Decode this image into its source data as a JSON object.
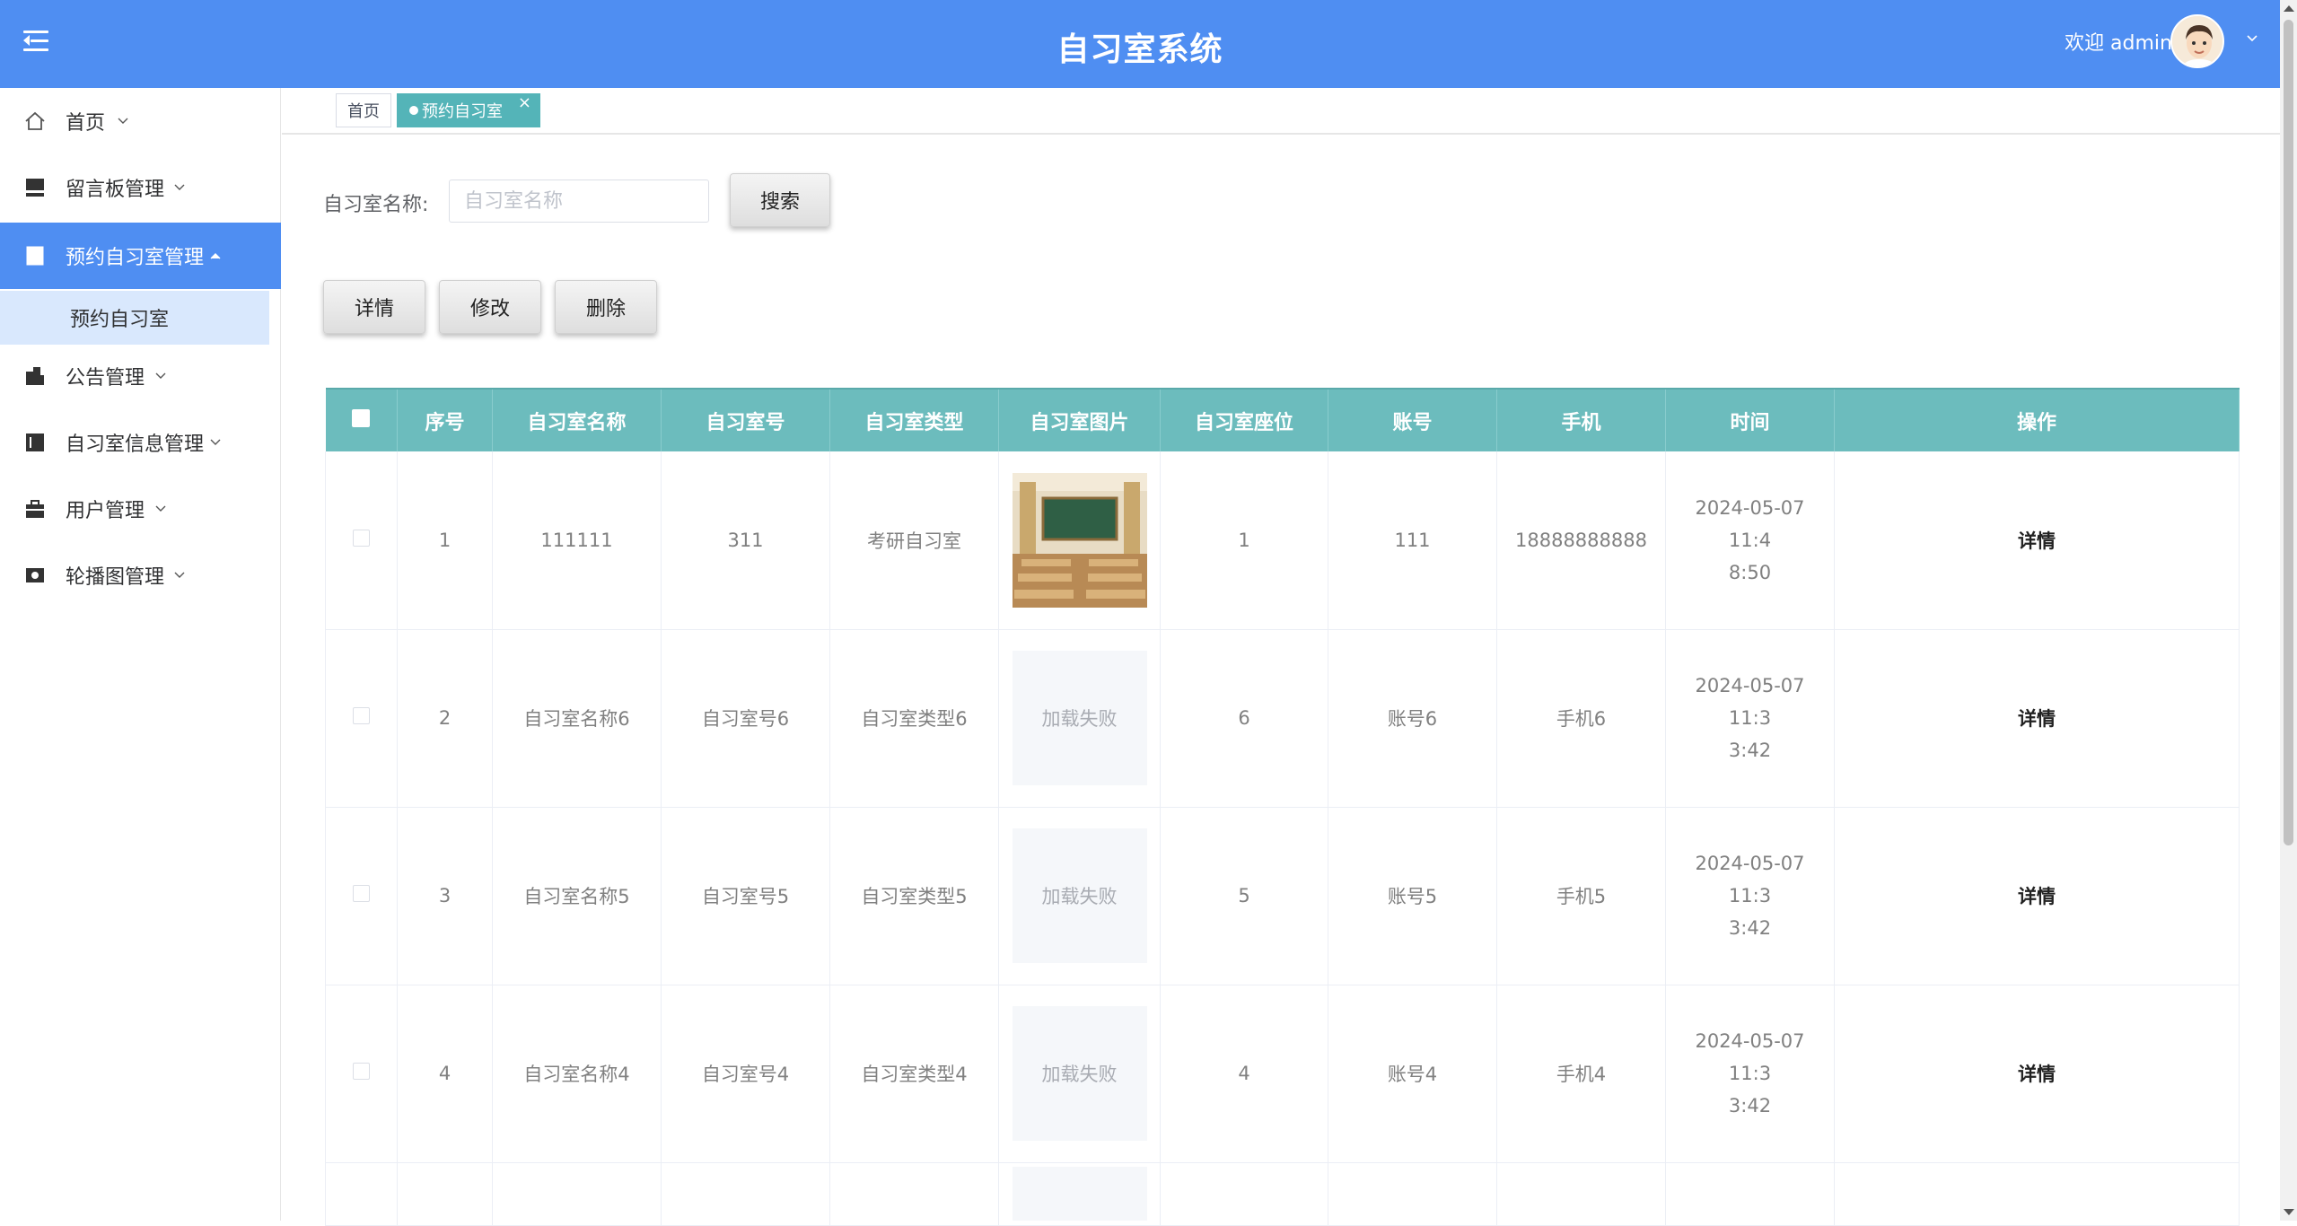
{
  "header": {
    "title": "自习室系统",
    "welcome": "欢迎 admin"
  },
  "sidebar": {
    "items": [
      {
        "label": "首页",
        "icon": "home-icon"
      },
      {
        "label": "留言板管理",
        "icon": "message-board-icon"
      },
      {
        "label": "预约自习室管理",
        "icon": "building-icon"
      },
      {
        "label": "公告管理",
        "icon": "notice-icon"
      },
      {
        "label": "自习室信息管理",
        "icon": "info-icon"
      },
      {
        "label": "用户管理",
        "icon": "user-briefcase-icon"
      },
      {
        "label": "轮播图管理",
        "icon": "carousel-icon"
      }
    ],
    "sub_item": "预约自习室",
    "active_color": "#4f8ef2"
  },
  "tabs": {
    "home": "首页",
    "current": "预约自习室",
    "close": "×"
  },
  "search": {
    "label": "自习室名称:",
    "placeholder": "自习室名称",
    "button": "搜索"
  },
  "actions": {
    "detail": "详情",
    "edit": "修改",
    "delete": "删除"
  },
  "table": {
    "columns": [
      "序号",
      "自习室名称",
      "自习室号",
      "自习室类型",
      "自习室图片",
      "自习室座位",
      "账号",
      "手机",
      "时间",
      "操作"
    ],
    "rows": [
      {
        "no": "1",
        "name": "111111",
        "room": "311",
        "type": "考研自习室",
        "image": "photo",
        "seats": "1",
        "account": "111",
        "phone": "18888888888",
        "time_1": "2024-05-07 11:4",
        "time_2": "8:50",
        "op": "详情"
      },
      {
        "no": "2",
        "name": "自习室名称6",
        "room": "自习室号6",
        "type": "自习室类型6",
        "image": "加载失败",
        "seats": "6",
        "account": "账号6",
        "phone": "手机6",
        "time_1": "2024-05-07 11:3",
        "time_2": "3:42",
        "op": "详情"
      },
      {
        "no": "3",
        "name": "自习室名称5",
        "room": "自习室号5",
        "type": "自习室类型5",
        "image": "加载失败",
        "seats": "5",
        "account": "账号5",
        "phone": "手机5",
        "time_1": "2024-05-07 11:3",
        "time_2": "3:42",
        "op": "详情"
      },
      {
        "no": "4",
        "name": "自习室名称4",
        "room": "自习室号4",
        "type": "自习室类型4",
        "image": "加载失败",
        "seats": "4",
        "account": "账号4",
        "phone": "手机4",
        "time_1": "2024-05-07 11:3",
        "time_2": "3:42",
        "op": "详情"
      }
    ],
    "header_color": "#6cbcbd"
  },
  "colors": {
    "header_bg": "#4f8ef2",
    "tab_active": "#54b4b8"
  }
}
